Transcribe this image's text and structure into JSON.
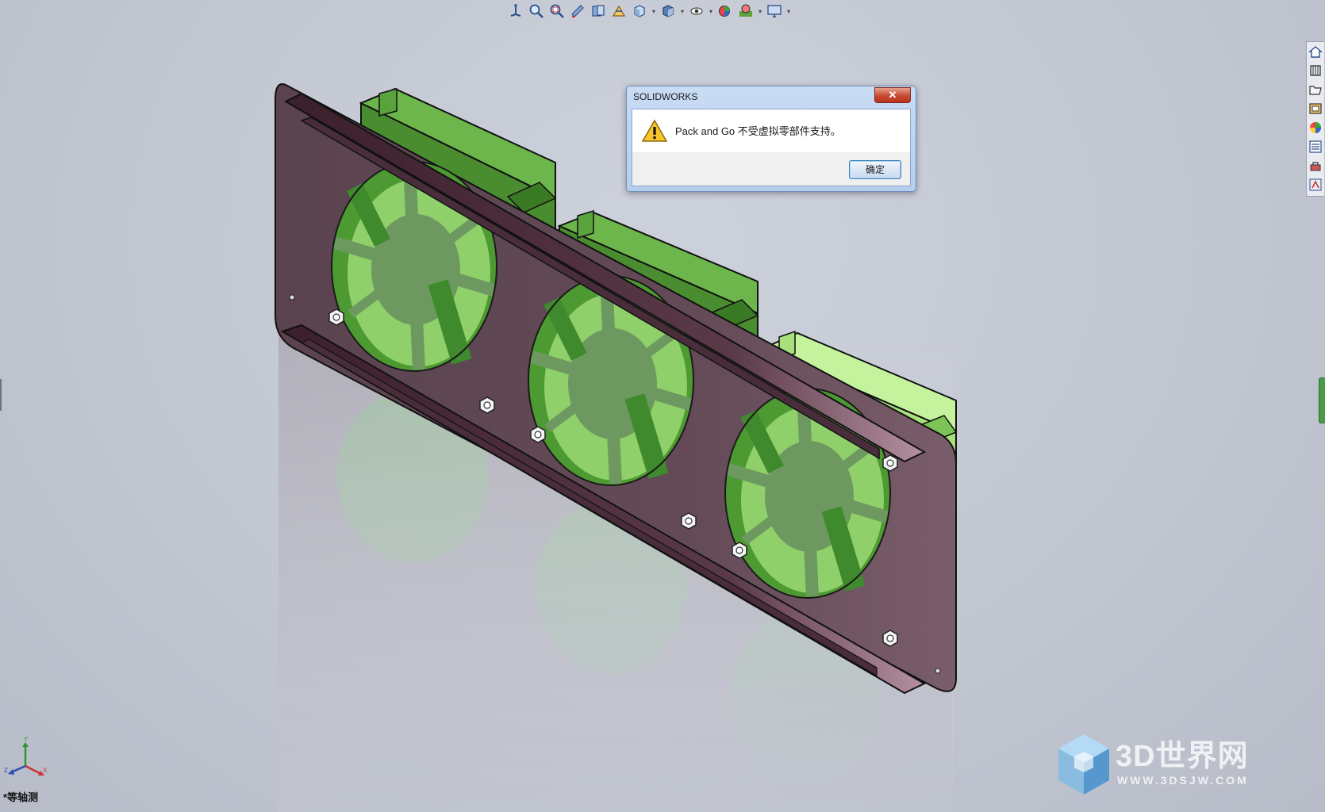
{
  "dialog": {
    "title": "SOLIDWORKS",
    "close_label": "✕",
    "message": "Pack and Go 不受虚拟零部件支持。",
    "ok_label": "确定"
  },
  "viewport": {
    "view_name": "*等轴测",
    "triad_labels": {
      "x": "X",
      "y": "Y",
      "z": "Z"
    }
  },
  "heads_up_toolbar": {
    "items": [
      "view-orientation-icon",
      "zoom-to-fit-icon",
      "zoom-to-area-icon",
      "previous-view-icon",
      "section-view-icon",
      "dynamic-annotation-icon",
      "view-orientation-cube-icon",
      "display-style-icon",
      "hide-show-items-icon",
      "edit-appearance-icon",
      "apply-scene-icon",
      "view-settings-icon"
    ]
  },
  "task_pane": {
    "tabs": [
      "home-icon",
      "design-library-icon",
      "file-explorer-icon",
      "view-palette-icon",
      "appearances-icon",
      "custom-properties-icon",
      "toolbox-icon",
      "forum-icon"
    ]
  },
  "watermark": {
    "name": "3D世界网",
    "url": "WWW.3DSJW.COM"
  },
  "colors": {
    "background": "#c3c7d2",
    "plate": "#5e4752",
    "fan_dark": "#3f8a2c",
    "fan_light": "#a8e07c",
    "dialog_frame": "#b6cdee"
  }
}
